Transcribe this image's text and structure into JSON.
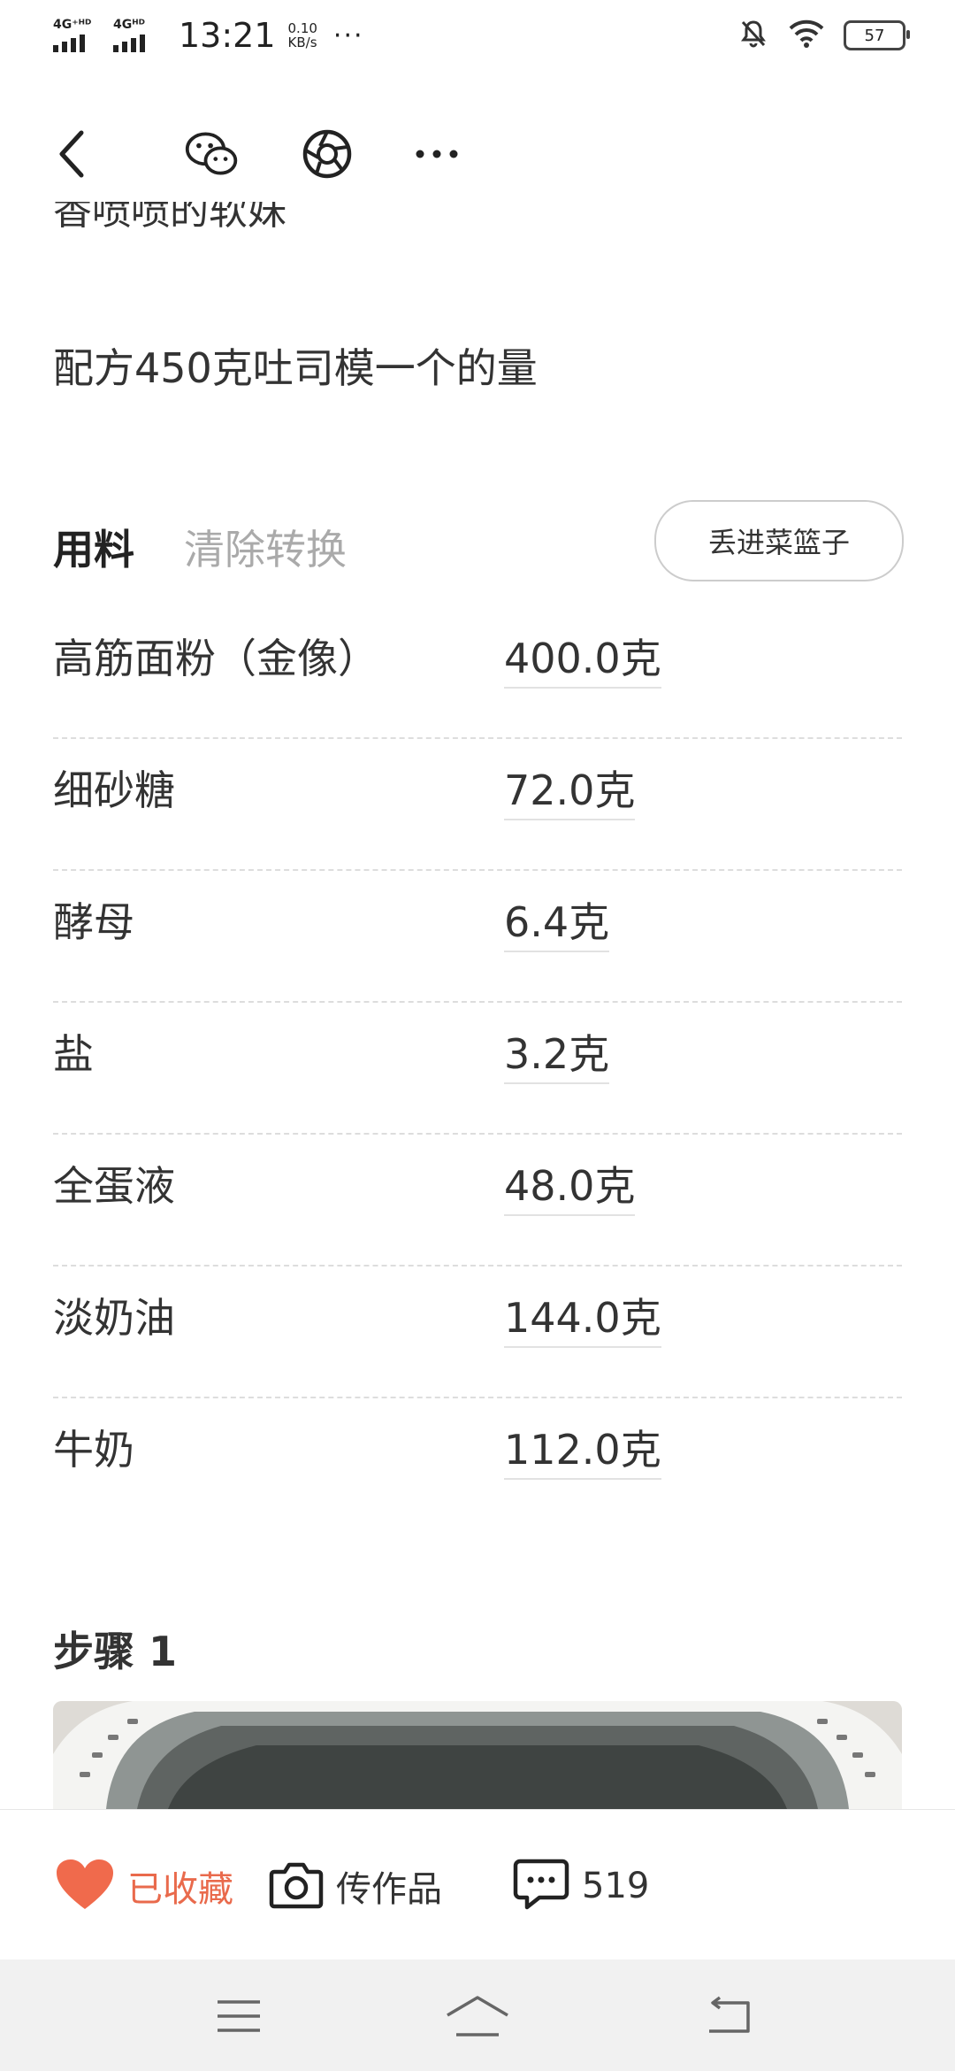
{
  "status_bar": {
    "signal1_label": "4G⁺ᴴᴰ",
    "signal2_label": "4Gᴴᴰ",
    "time": "13:21",
    "speed_value": "0.10",
    "speed_unit": "KB/s",
    "more": "···",
    "battery": "57"
  },
  "toolbar": {
    "back_icon": "back-arrow-icon",
    "wechat_icon": "wechat-icon",
    "moments_icon": "moments-shutter-icon",
    "more_icon": "more-dots-icon"
  },
  "content": {
    "cut_text": "香喷喷的软妹",
    "recipe_note": "配方450克吐司模一个的量"
  },
  "ingredients": {
    "title": "用料",
    "clear_conversion": "清除转换",
    "basket_button": "丢进菜篮子",
    "items": [
      {
        "name": "高筋面粉（金像）",
        "amount": "400.0克"
      },
      {
        "name": "细砂糖",
        "amount": "72.0克"
      },
      {
        "name": "酵母",
        "amount": "6.4克"
      },
      {
        "name": "盐",
        "amount": "3.2克"
      },
      {
        "name": "全蛋液",
        "amount": "48.0克"
      },
      {
        "name": "淡奶油",
        "amount": "144.0克"
      },
      {
        "name": "牛奶",
        "amount": "112.0克"
      }
    ]
  },
  "step": {
    "title": "步骤 1"
  },
  "action_bar": {
    "favorite_label": "已收藏",
    "upload_label": "传作品",
    "comment_count": "519"
  },
  "colors": {
    "accent": "#e96a4c",
    "heart": "#f06a4c",
    "muted": "#aaaaaa"
  }
}
